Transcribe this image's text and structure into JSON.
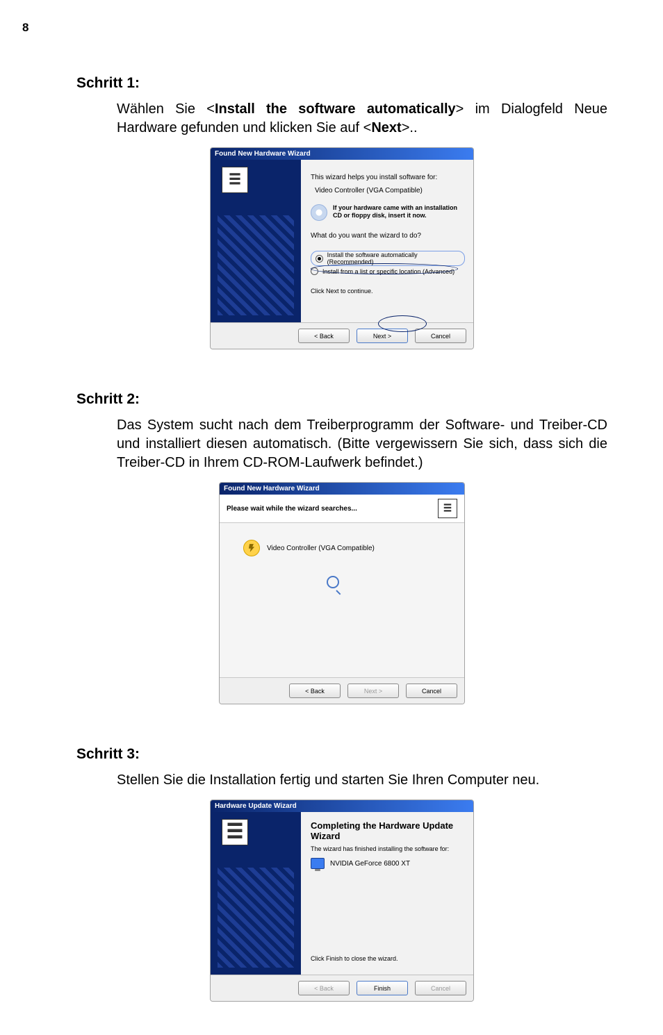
{
  "page_number": "8",
  "s1": {
    "heading": "Schritt 1:",
    "p_pre": "Wählen Sie <",
    "p_bold": "Install the software automatically",
    "p_mid": "> im Dialogfeld Neue Hardware gefunden und klicken Sie auf <",
    "p_bold2": "Next",
    "p_post": ">.."
  },
  "wiz1": {
    "title": "Found New Hardware Wizard",
    "line1": "This wizard helps you install software for:",
    "device": "Video Controller (VGA Compatible)",
    "tip": "If your hardware came with an installation CD or floppy disk, insert it now.",
    "question": "What do you want the wizard to do?",
    "opt1": "Install the software automatically (Recommended)",
    "opt2": "Install from a list or specific location (Advanced)",
    "click_next": "Click Next to continue.",
    "back": "< Back",
    "next": "Next >",
    "cancel": "Cancel"
  },
  "s2": {
    "heading": "Schritt 2:",
    "p": "Das System sucht nach dem Treiberprogramm der Software- und Treiber-CD und installiert diesen automatisch. (Bitte vergewissern Sie sich, dass sich die Treiber-CD in Ihrem CD-ROM-Laufwerk befindet.)"
  },
  "wiz2": {
    "title": "Found New Hardware Wizard",
    "header": "Please wait while the wizard searches...",
    "device": "Video Controller (VGA Compatible)",
    "back": "< Back",
    "next": "Next >",
    "cancel": "Cancel"
  },
  "s3": {
    "heading": "Schritt 3:",
    "p": "Stellen Sie die Installation fertig und starten Sie Ihren Computer neu."
  },
  "wiz3": {
    "title": "Hardware Update Wizard",
    "completing": "Completing the Hardware Update Wizard",
    "finished": "The wizard has finished installing the software for:",
    "device": "NVIDIA GeForce 6800 XT",
    "click_finish": "Click Finish to close the wizard.",
    "back": "< Back",
    "finish": "Finish",
    "cancel": "Cancel"
  }
}
